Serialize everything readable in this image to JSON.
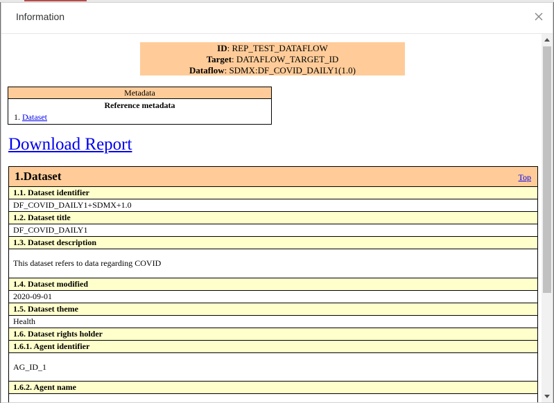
{
  "dialog": {
    "title": "Information"
  },
  "summary": {
    "id_label": "ID",
    "id_value": ": REP_TEST_DATAFLOW",
    "target_label": "Target",
    "target_value": ": DATAFLOW_TARGET_ID",
    "dataflow_label": "Dataflow",
    "dataflow_value": ": SDMX:DF_COVID_DAILY1(1.0)"
  },
  "metadata": {
    "heading": "Metadata",
    "subheading": "Reference metadata",
    "items": [
      {
        "index": "1. ",
        "label": "Dataset"
      }
    ]
  },
  "download_label": "Download Report",
  "section": {
    "title": "1.Dataset",
    "top_link": "Top",
    "rows": [
      {
        "label": "1.1. Dataset identifier",
        "value": "DF_COVID_DAILY1+SDMX+1.0"
      },
      {
        "label": "1.2. Dataset title",
        "value": "DF_COVID_DAILY1"
      },
      {
        "label": "1.3. Dataset description",
        "value": "This dataset refers to data regarding COVID"
      },
      {
        "label": "1.4. Dataset modified",
        "value": "2020-09-01"
      },
      {
        "label": "1.5. Dataset theme",
        "value": "Health"
      },
      {
        "label": "1.6. Dataset rights holder",
        "value": ""
      },
      {
        "label": "1.6.1. Agent identifier",
        "value": "AG_ID_1"
      },
      {
        "label": "1.6.2. Agent name",
        "value": ""
      }
    ]
  },
  "colors": {
    "header_bg": "#ffcc99",
    "label_bg": "#ffffcc",
    "link": "#0000ee"
  }
}
